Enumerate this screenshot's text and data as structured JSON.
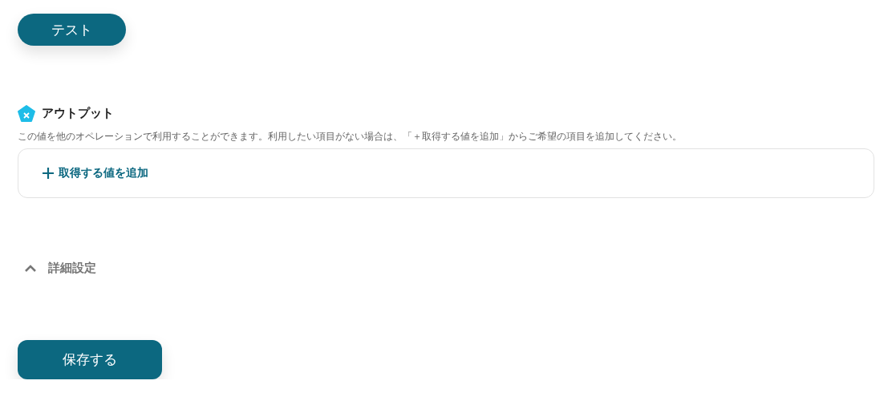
{
  "test_button": {
    "label": "テスト"
  },
  "output": {
    "title": "アウトプット",
    "description": "この値を他のオペレーションで利用することができます。利用したい項目がない場合は、「＋取得する値を追加」からご希望の項目を追加してください。",
    "add_button": {
      "label": "取得する値を追加"
    }
  },
  "advanced": {
    "label": "詳細設定",
    "expanded": true
  },
  "save_button": {
    "label": "保存する"
  }
}
